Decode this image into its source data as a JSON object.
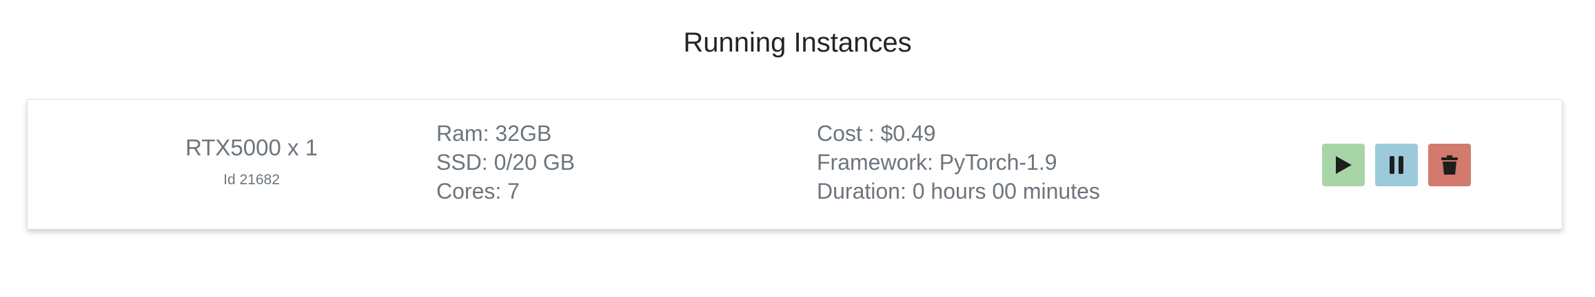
{
  "page": {
    "title": "Running Instances"
  },
  "instance": {
    "gpu": "RTX5000 x 1",
    "id_label": "Id 21682",
    "ram": "Ram: 32GB",
    "ssd": "SSD: 0/20 GB",
    "cores": "Cores: 7",
    "cost": "Cost : $0.49",
    "framework": "Framework: PyTorch-1.9",
    "duration": "Duration: 0 hours 00 minutes"
  },
  "actions": {
    "start": {
      "icon": "play-icon",
      "color": "#a8d5a8"
    },
    "pause": {
      "icon": "pause-icon",
      "color": "#9ccadb"
    },
    "delete": {
      "icon": "trash-icon",
      "color": "#d17a6d"
    }
  },
  "colors": {
    "text_muted": "#6c757d",
    "title": "#212529",
    "icon": "#1e1e1e"
  }
}
